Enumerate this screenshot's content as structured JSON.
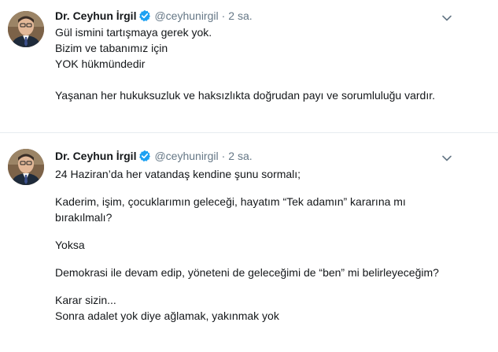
{
  "tweets": [
    {
      "name": "Dr. Ceyhun İrgil",
      "handle": "@ceyhunirgil",
      "separator": "·",
      "time": "2 sa.",
      "lines": [
        "Gül ismini tartışmaya gerek yok.",
        "Bizim ve tabanımız için",
        "YOK hükmündedir",
        "",
        "Yaşanan her hukuksuzluk ve haksızlıkta doğrudan payı ve sorumluluğu vardır."
      ]
    },
    {
      "name": "Dr. Ceyhun İrgil",
      "handle": "@ceyhunirgil",
      "separator": "·",
      "time": "2 sa.",
      "lines": [
        "24 Haziran’da her vatandaş kendine şunu sormalı;",
        "",
        "Kaderim, işim, çocuklarımın geleceği, hayatım “Tek adamın” kararına mı",
        "bırakılmalı?",
        "",
        "Yoksa",
        "",
        "Demokrasi ile devam edip, yöneteni de geleceğimi de “ben” mi belirleyeceğim?",
        "",
        "Karar sizin...",
        "Sonra adalet yok diye ağlamak, yakınmak yok"
      ]
    }
  ],
  "icons": {
    "verified": "verified-badge-icon",
    "more": "chevron-down-icon"
  },
  "colors": {
    "text": "#14171a",
    "secondary": "#657786",
    "verified": "#1da1f2",
    "divider": "#e6ecf0"
  }
}
